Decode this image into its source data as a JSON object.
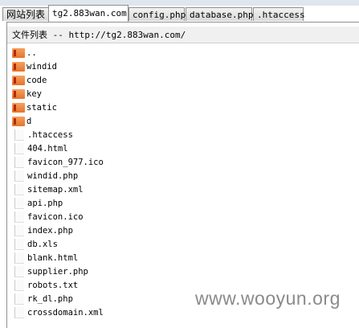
{
  "tabs": [
    "网站列表",
    "tg2.883wan.com",
    "config.php",
    "database.php",
    ".htaccess"
  ],
  "active_tab": 1,
  "header": "文件列表 -- http://tg2.883wan.com/",
  "items": [
    {
      "name": "..",
      "type": "folder"
    },
    {
      "name": "windid",
      "type": "folder"
    },
    {
      "name": "code",
      "type": "folder"
    },
    {
      "name": "key",
      "type": "folder"
    },
    {
      "name": "static",
      "type": "folder"
    },
    {
      "name": "d",
      "type": "folder"
    },
    {
      "name": ".htaccess",
      "type": "file"
    },
    {
      "name": "404.html",
      "type": "file"
    },
    {
      "name": "favicon_977.ico",
      "type": "file"
    },
    {
      "name": "windid.php",
      "type": "file"
    },
    {
      "name": "sitemap.xml",
      "type": "file"
    },
    {
      "name": "api.php",
      "type": "file"
    },
    {
      "name": "favicon.ico",
      "type": "file"
    },
    {
      "name": "index.php",
      "type": "file"
    },
    {
      "name": "db.xls",
      "type": "file"
    },
    {
      "name": "blank.html",
      "type": "file"
    },
    {
      "name": "supplier.php",
      "type": "file"
    },
    {
      "name": "robots.txt",
      "type": "file"
    },
    {
      "name": "rk_dl.php",
      "type": "file"
    },
    {
      "name": "crossdomain.xml",
      "type": "file"
    }
  ],
  "watermark": "www.wooyun.org"
}
